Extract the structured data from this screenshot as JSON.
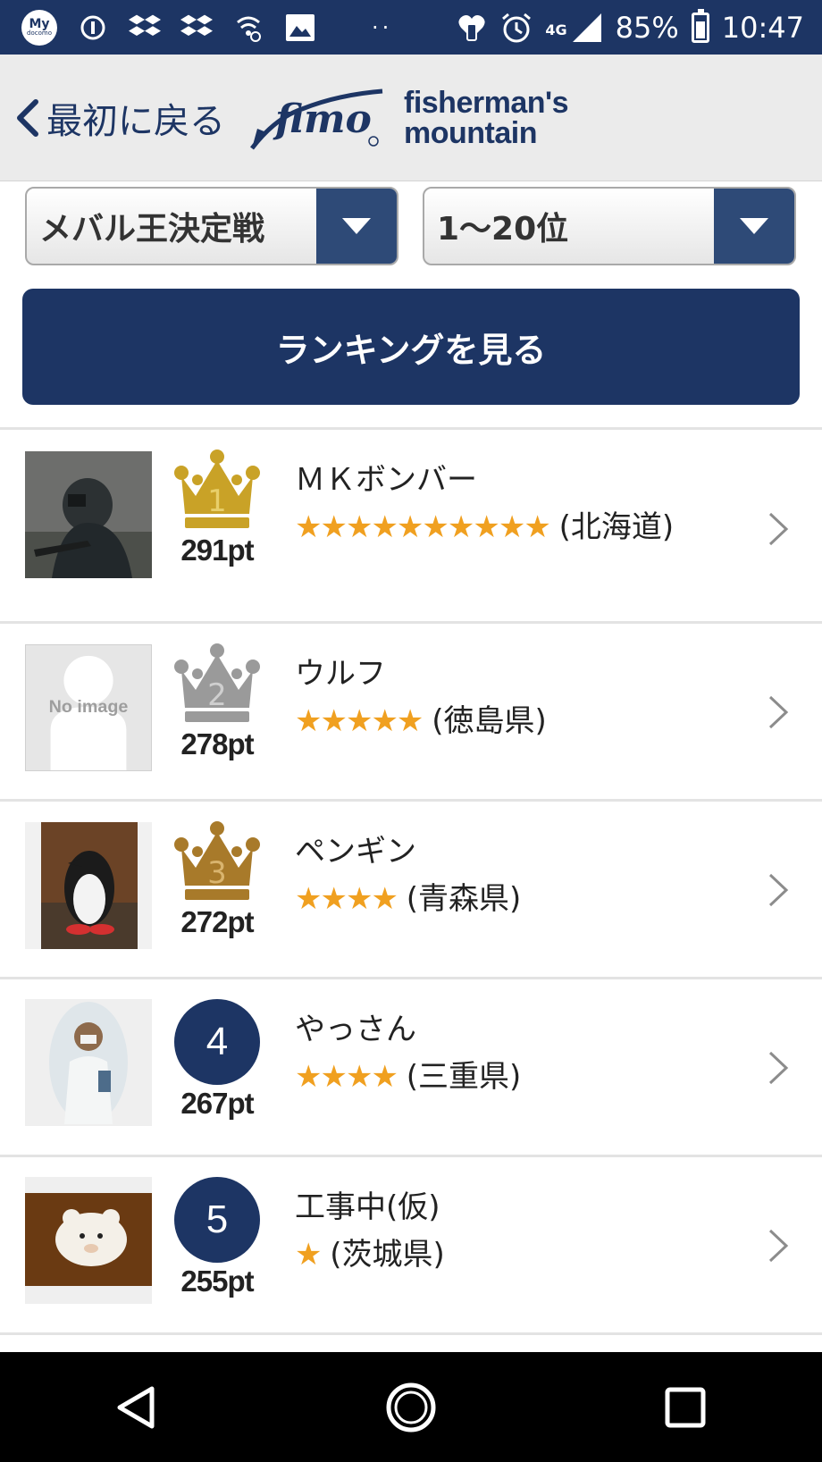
{
  "status_bar": {
    "carrier_top": "My",
    "carrier_bottom": "docomo",
    "network": "4G",
    "battery": "85%",
    "time": "10:47",
    "icons": [
      "docomo-icon",
      "info-icon",
      "dropbox-icon",
      "dropbox-icon",
      "wifi-settings-icon",
      "image-icon",
      "heart-phone-icon",
      "alarm-icon",
      "signal-icon",
      "battery-icon"
    ]
  },
  "header": {
    "back_label": "最初に戻る",
    "logo_mark": "fimo",
    "logo_line1": "fisherman's",
    "logo_line2": "mountain"
  },
  "filters": {
    "contest": "メバル王決定戦",
    "range": "1〜20位"
  },
  "view_button": "ランキングを見る",
  "rankings": [
    {
      "rank": "1",
      "points": "291pt",
      "name": "ＭＫボンバー",
      "stars": "★★★★★★★★★★",
      "region": "(北海道)",
      "medal": "gold",
      "thumb": "photo"
    },
    {
      "rank": "2",
      "points": "278pt",
      "name": "ウルフ",
      "stars": "★★★★★",
      "region": "(徳島県)",
      "medal": "silver",
      "thumb": "no-image",
      "no_image_text": "No image"
    },
    {
      "rank": "3",
      "points": "272pt",
      "name": "ペンギン",
      "stars": "★★★★",
      "region": "(青森県)",
      "medal": "bronze",
      "thumb": "photo"
    },
    {
      "rank": "4",
      "points": "267pt",
      "name": "やっさん",
      "stars": "★★★★",
      "region": "(三重県)",
      "medal": "none",
      "thumb": "photo"
    },
    {
      "rank": "5",
      "points": "255pt",
      "name": "工事中(仮)",
      "stars": "★",
      "region": "(茨城県)",
      "medal": "none",
      "thumb": "photo"
    }
  ],
  "colors": {
    "navy": "#1d3564",
    "star": "#f0a020",
    "gold": "#c9a227",
    "silver": "#9a9a9a",
    "bronze": "#a87a2a"
  }
}
